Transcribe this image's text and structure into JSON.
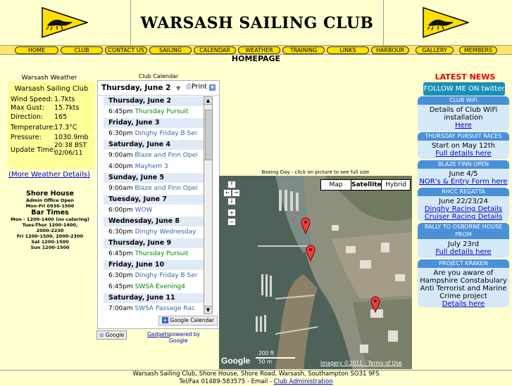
{
  "header": {
    "title": "WARSASH SAILING CLUB"
  },
  "nav": [
    "HOME",
    "CLUB",
    "CONTACT US",
    "SAILING",
    "CALENDAR",
    "WEATHER",
    "TRAINING",
    "LINKS",
    "HARBOUR",
    "GALLERY",
    "MEMBERS"
  ],
  "page_heading": "HOMEPAGE",
  "weather": {
    "section_title": "Warsash Weather",
    "station": "Warsash Sailing Club",
    "rows": [
      {
        "label": "Wind Speed:",
        "value": "1.7kts"
      },
      {
        "label": "Max Gust:",
        "value": "15.7kts"
      },
      {
        "label": "Direction:",
        "value": "165"
      },
      {
        "label": "Temperature:",
        "value": "17.3°C"
      },
      {
        "label": "Pressure:",
        "value": "1030.9mb"
      },
      {
        "label": "Update Time:",
        "value": "20:38 BST 02/06/11"
      }
    ],
    "more_link": "(More Weather Details)"
  },
  "shore_house": {
    "title": "Shore House",
    "office_title": "Admin Office Open",
    "office_hours": "Mon-Fri 0930-1500",
    "bar_title": "Bar Times",
    "bar_lines": [
      "Mon - 1200-1400 (no catering)",
      "Tues-Thur 1200-1400,",
      "2000-2230",
      "Fri 1200-1500, 2000-2300",
      "Sat 1200-1500",
      "Sun 1200-1500"
    ]
  },
  "calendar": {
    "label": "Club Calendar",
    "current_date": "Thursday, June 2",
    "print_label": "Print",
    "entries": [
      {
        "kind": "day",
        "text": "Thursday, June 2"
      },
      {
        "kind": "event",
        "time": "6:45pm",
        "title": "Thursday Pursuit",
        "color": "green"
      },
      {
        "kind": "day",
        "text": "Friday, June 3"
      },
      {
        "kind": "event",
        "time": "6:30pm",
        "title": "Dinghy Friday B Ser",
        "color": "blue"
      },
      {
        "kind": "day",
        "text": "Saturday, June 4"
      },
      {
        "kind": "event",
        "time": "9:00am",
        "title": "Blaze and Finn Opei",
        "color": "blue"
      },
      {
        "kind": "event",
        "time": "4:00pm",
        "title": "Mayhem 3",
        "color": "blue"
      },
      {
        "kind": "day",
        "text": "Sunday, June 5"
      },
      {
        "kind": "event",
        "time": "9:00am",
        "title": "Blaze and Finn Opei",
        "color": "blue"
      },
      {
        "kind": "day",
        "text": "Tuesday, June 7"
      },
      {
        "kind": "event",
        "time": "6:00pm",
        "title": "WOW",
        "color": "blue"
      },
      {
        "kind": "day",
        "text": "Wednesday, June 8"
      },
      {
        "kind": "event",
        "time": "6:30pm",
        "title": "Dinghy Wednesday",
        "color": "blue"
      },
      {
        "kind": "day",
        "text": "Thursday, June 9"
      },
      {
        "kind": "event",
        "time": "6:45pm",
        "title": "Thursday Pursuit",
        "color": "green"
      },
      {
        "kind": "day",
        "text": "Friday, June 10"
      },
      {
        "kind": "event",
        "time": "6:30pm",
        "title": "Dinghy Friday B Ser",
        "color": "blue"
      },
      {
        "kind": "event",
        "time": "6:45pm",
        "title": "SWSA Evening4",
        "color": "green"
      },
      {
        "kind": "day",
        "text": "Saturday, June 11"
      },
      {
        "kind": "event",
        "time": "7:00am",
        "title": "SWSA Passage Rac",
        "color": "blue"
      }
    ],
    "footer_brand": "Google Calendar",
    "google_button": "Google",
    "gadgets_link": "Gadgets",
    "powered_by": "powered by Google"
  },
  "map": {
    "label": "Boxing Day - click on picture to see full size",
    "map_type_buttons": [
      "Map",
      "Satellite",
      "Hybrid"
    ],
    "scale_ft": "200 ft",
    "scale_m": "50 m",
    "copyright": "Imagery ©2011 - Terms of Use",
    "logo": "Google"
  },
  "news": {
    "title": "LATEST NEWS",
    "follow_label": "FOLLOW ME ON twitter",
    "items": [
      {
        "head": "CLUB WiFi",
        "body": "Details of Club WiFi installation",
        "link": "Here"
      },
      {
        "head": "THURSDAY PURSUIT RACES",
        "body": "Start on May 12th",
        "link": "Full details here"
      },
      {
        "head": "BLAZE FINN OPEN",
        "body": "June 4/5",
        "link": "NOR's & Entry Form here"
      },
      {
        "head": "RHCC REGATTA",
        "body": "June 22/23/24",
        "link": "Dinghy Racing Details",
        "link2": "Cruiser Racing Details"
      },
      {
        "head": "RALLY TO OSBORNE HOUSE PROM",
        "body": "July 23rd",
        "link": "Full details here"
      },
      {
        "head": "PROJECT KRAKEN",
        "body": "Are you aware of Hampshire Constabulary Anti Terrorist and Marine Crime project",
        "link": "Details here"
      }
    ]
  },
  "footer": {
    "address": "Warsash Sailing Club, Shore House, Shore Road, Warsash, Southampton SO31 9FS",
    "tel": "Tel/Fax 01489-583575 - Email -",
    "admin_link": "Club Administration"
  },
  "colors": {
    "background": "#ffffd0",
    "nav_button": "#ffe000",
    "news_header": "#4a90d9",
    "news_title": "#ee0000"
  }
}
